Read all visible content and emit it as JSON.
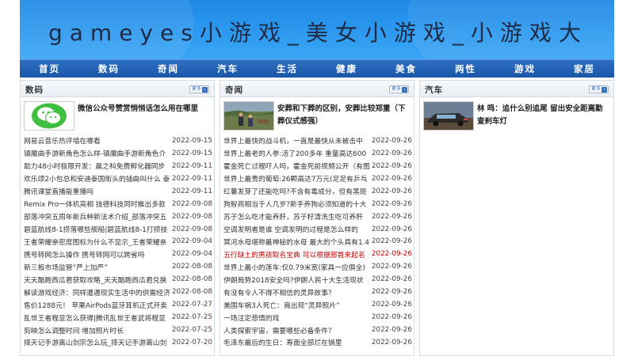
{
  "site": {
    "title": "gameyes小游戏_美女小游戏_小游戏大"
  },
  "nav": [
    "首页",
    "数码",
    "奇闻",
    "汽车",
    "生活",
    "健康",
    "美食",
    "两性",
    "游戏",
    "家居"
  ],
  "more_label": "更多",
  "panels": [
    {
      "title": "数码",
      "feature": {
        "title": "微信公众号赞赏悄悄话怎么用在哪里",
        "icon": "wechat-icon"
      },
      "items": [
        {
          "title": "网易云音乐热评墙在哪看",
          "date": "2022-09-15"
        },
        {
          "title": "镇魔曲手游新角色怎么样-镇魔曲手游新角色介",
          "date": "2022-09-15"
        },
        {
          "title": "助力48小时极限开发：晨之科免费孵化器同步",
          "date": "2022-09-11"
        },
        {
          "title": "欢乐颂2小包总和安迪泰国街头的插曲叫什么 泰",
          "date": "2022-09-11"
        },
        {
          "title": "腾讯课堂直播能重播吗",
          "date": "2022-09-11"
        },
        {
          "title": "Remix Pro一体机亮相 技德科技同时推出多款",
          "date": "2022-09-08"
        },
        {
          "title": "部落冲突五周年新兵种新法术介绍_部落冲突五",
          "date": "2022-09-08"
        },
        {
          "title": "碧蓝航线8-1捞落哪些舰船|碧蓝航线8-1打捞技",
          "date": "2022-09-08"
        },
        {
          "title": "王者荣耀亲密度图标为什么不显示_王者荣耀亲",
          "date": "2022-09-04"
        },
        {
          "title": "携号转网怎么操作 携号转网可以跨省吗",
          "date": "2022-09-04"
        },
        {
          "title": "新三板市场监管“严上加严”",
          "date": "2022-08-08"
        },
        {
          "title": "天天酷跑西瓜君获取攻略_天天酷跑西瓜君兑换",
          "date": "2022-08-08"
        },
        {
          "title": "解读游戏经济：同样遭遇现实生活中的供需经济",
          "date": "2022-08-08"
        },
        {
          "title": "售价1288元！ 苹果AirPods蓝牙耳机正式开卖",
          "date": "2022-07-27"
        },
        {
          "title": "乱世王者程显怎么获得|腾讯乱世王者武将程显",
          "date": "2022-07-25"
        },
        {
          "title": "剪映怎么调整时间 增加照片时长",
          "date": "2022-07-25"
        },
        {
          "title": "择天记手游离山剑宗怎么玩_择天记手游离山剑",
          "date": "2022-07-20"
        }
      ]
    },
    {
      "title": "奇闻",
      "feature": {
        "title": "安葬和下葬的区别，安葬比较郑重（下葬仪式感强）",
        "icon": "burial-photo-icon"
      },
      "items": [
        {
          "title": "世界上最快的战斗机，一直是最快从未被击中",
          "date": "2022-09-26"
        },
        {
          "title": "世界上最老的人参:活了200多年 重量高达600",
          "date": "2022-09-26"
        },
        {
          "title": "霍金死亡过程吓人吗，霍金死前视频公开（有图",
          "date": "2022-09-26"
        },
        {
          "title": "世界上最贵的葡萄:26颗高达7万元(足足有乒乓",
          "date": "2022-09-26"
        },
        {
          "title": "红薯发芽了还能吃吗?不含有毒成分，但有黑斑",
          "date": "2022-09-26"
        },
        {
          "title": "狗智商相当于人几岁?新手养狗必须知道的十大",
          "date": "2022-09-26"
        },
        {
          "title": "苏子怎么吃才能养肝，苏子籽清洗生吃可养肝",
          "date": "2022-09-26"
        },
        {
          "title": "空调发明者是谁 空调发明的过程是怎么样的",
          "date": "2022-09-26"
        },
        {
          "title": "冥河水母堪称最神秘的水母 最大的个头具有1.4",
          "date": "2022-09-26"
        },
        {
          "title": "五行缺土的男孩取名宝典 可以根据部首来起名",
          "date": "2022-09-26",
          "hot": true
        },
        {
          "title": "世界上最小的莲车:仅0.79米宽(家具一应俱全)",
          "date": "2022-09-26"
        },
        {
          "title": "伊朗局势2018安全吗?伊朗人民十大生活现状",
          "date": "2022-09-26"
        },
        {
          "title": "有没有令人不得不相信的灵异故事？",
          "date": "2022-09-26"
        },
        {
          "title": "美国车祸3人死亡：竟出现“灵异照片”",
          "date": "2022-09-26"
        },
        {
          "title": "一场注定悲情的戏",
          "date": "2022-09-26"
        },
        {
          "title": "人类探索宇宙，需要哪些必备条件？",
          "date": "2022-09-26"
        },
        {
          "title": "毛泽东最后的生日：寿面全部烂在锅里",
          "date": "2022-09-26"
        }
      ]
    },
    {
      "title": "汽车",
      "feature": {
        "title": "林 鸣：追什么别追尾 留出安全距离勤查刹车灯",
        "icon": "car-photo-icon"
      },
      "items": []
    }
  ]
}
